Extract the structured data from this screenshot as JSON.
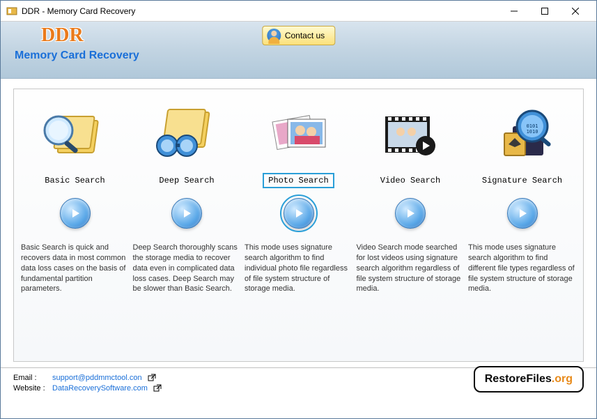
{
  "window": {
    "title": "DDR - Memory Card Recovery"
  },
  "header": {
    "logo_text": "DDR",
    "subtitle": "Memory Card Recovery",
    "contact_label": "Contact us"
  },
  "options": [
    {
      "title": "Basic Search",
      "desc": "Basic Search is quick and recovers data in most common data loss cases on the basis of fundamental partition parameters.",
      "selected": false
    },
    {
      "title": "Deep Search",
      "desc": "Deep Search thoroughly scans the storage media to recover data even in complicated data loss cases. Deep Search may be slower than Basic Search.",
      "selected": false
    },
    {
      "title": "Photo Search",
      "desc": "This mode uses signature search algorithm to find individual photo file regardless of file system structure of storage media.",
      "selected": true
    },
    {
      "title": "Video Search",
      "desc": "Video Search mode searched for lost videos using signature search algorithm regardless of file system structure of storage media.",
      "selected": false
    },
    {
      "title": "Signature Search",
      "desc": "This mode uses signature search algorithm to find different file types regardless of file system structure of storage media.",
      "selected": false
    }
  ],
  "footer": {
    "email_label": "Email :",
    "email_value": "support@pddmmctool.con",
    "website_label": "Website :",
    "website_value": "DataRecoverySoftware.com",
    "restore_brand_a": "RestoreFiles",
    "restore_brand_b": ".org"
  }
}
